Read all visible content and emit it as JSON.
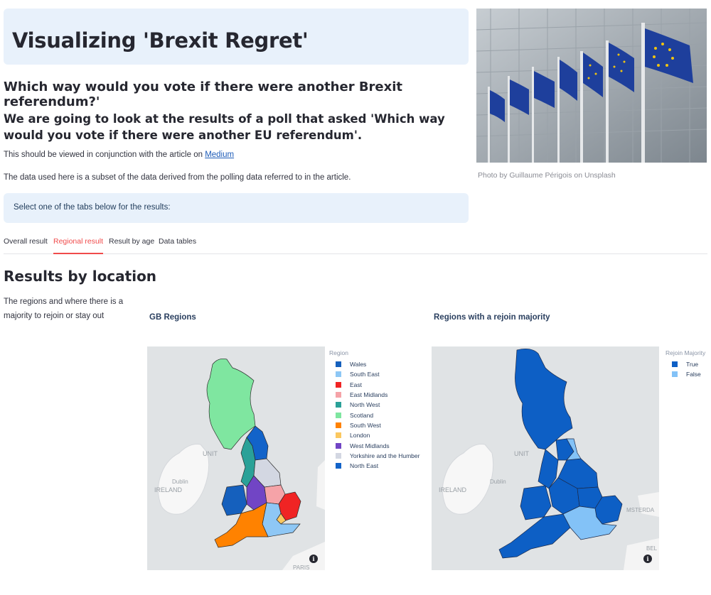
{
  "header": {
    "title": "Visualizing 'Brexit Regret'",
    "subtitle": "Which way would you vote if there were another Brexit referendum?'",
    "intro": "We are going to look at the results of a poll that asked 'Which way would you vote if there were another EU referendum'.",
    "article_text": "This should be viewed in conjunction with the article on ",
    "article_link": "Medium",
    "data_note": "The data used here is a subset of the data derived from the polling data referred to in the article.",
    "info": "Select one of the tabs below for the results:"
  },
  "photo": {
    "caption": "Photo by Guillaume Périgois on Unsplash"
  },
  "tabs": [
    {
      "label": "Overall result",
      "active": false
    },
    {
      "label": "Regional result",
      "active": true
    },
    {
      "label": "Result by age",
      "active": false
    },
    {
      "label": "Data tables",
      "active": false
    }
  ],
  "section": {
    "title": "Results by location",
    "description": "The regions and where there is a majority to rejoin or stay out"
  },
  "maps": {
    "regions": {
      "title": "GB Regions",
      "legend_title": "Region",
      "legend": [
        {
          "label": "Wales",
          "color": "#1560bd"
        },
        {
          "label": "South East",
          "color": "#8ec7f5"
        },
        {
          "label": "East",
          "color": "#f02424"
        },
        {
          "label": "East Midlands",
          "color": "#f5a3a8"
        },
        {
          "label": "North West",
          "color": "#2aa198"
        },
        {
          "label": "Scotland",
          "color": "#7fe6a0"
        },
        {
          "label": "South West",
          "color": "#ff8200"
        },
        {
          "label": "London",
          "color": "#fbc860"
        },
        {
          "label": "West Midlands",
          "color": "#7145c5"
        },
        {
          "label": "Yorkshire and the Humber",
          "color": "#d3d7e2"
        },
        {
          "label": "North East",
          "color": "#1263c9"
        }
      ],
      "basemap_labels": {
        "ireland": "IRELAND",
        "dublin": "Dublin",
        "united": "UNIT",
        "paris": "PARIS"
      }
    },
    "rejoin": {
      "title": "Regions with a rejoin majority",
      "legend_title": "Rejoin Majority",
      "legend": [
        {
          "label": "True",
          "color": "#0d5fc5"
        },
        {
          "label": "False",
          "color": "#83c2f7"
        }
      ],
      "basemap_labels": {
        "ireland": "IRELAND",
        "dublin": "Dublin",
        "united": "UNIT",
        "amsterdam": "MSTERDA",
        "bel": "BEL"
      }
    },
    "info_icon": "i"
  },
  "colors": {
    "active_tab": "#f04b4b",
    "title_bg": "#e8f1fb",
    "link": "#1c5bb8"
  }
}
